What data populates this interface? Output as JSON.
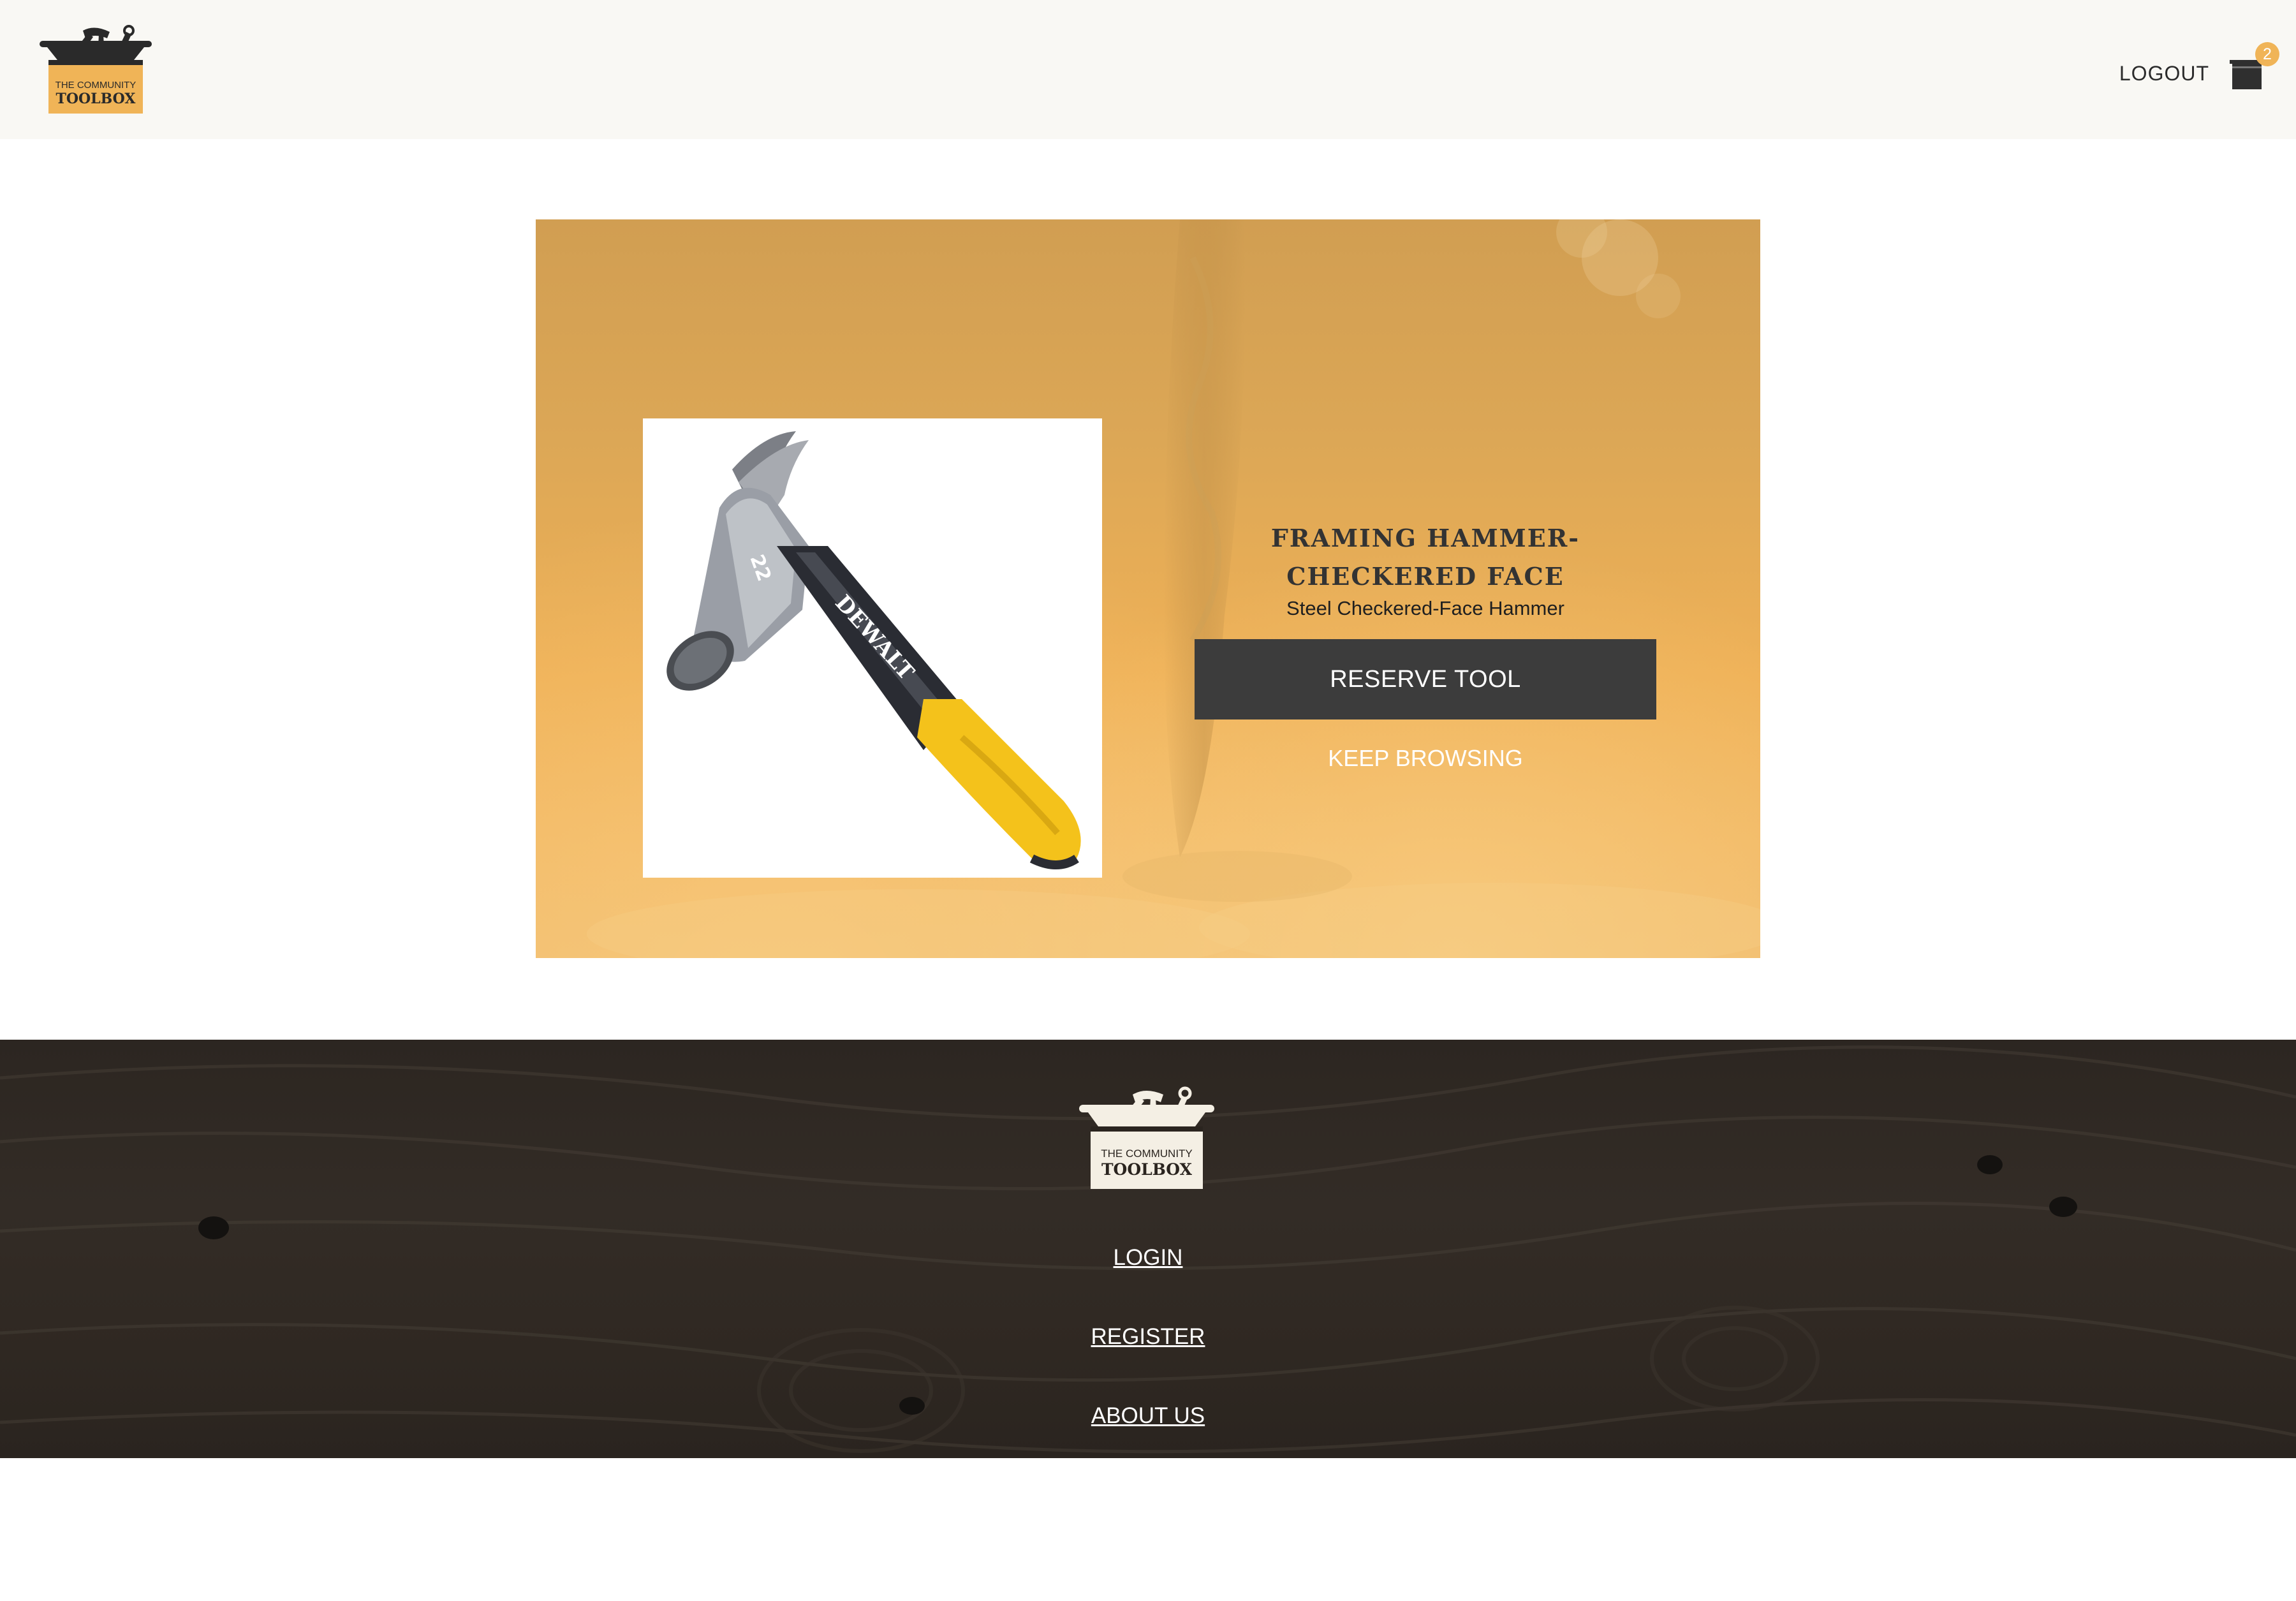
{
  "header": {
    "logo": {
      "icon": "toolbox-logo",
      "line1": "THE COMMUNITY",
      "line2": "TOOLBOX"
    },
    "logout_label": "LOGOUT",
    "cart": {
      "icon": "toolbox-cart-icon",
      "count": "2"
    }
  },
  "product": {
    "image_icon": "framing-hammer-image",
    "image_brand": "DEWALT",
    "image_number": "22",
    "title": "FRAMING HAMMER-CHECKERED FACE",
    "subtitle": "Steel Checkered-Face Hammer",
    "reserve_label": "RESERVE TOOL",
    "browse_label": "KEEP BROWSING"
  },
  "footer": {
    "logo": {
      "icon": "toolbox-logo",
      "line1": "THE COMMUNITY",
      "line2": "TOOLBOX"
    },
    "links": [
      "LOGIN",
      "REGISTER",
      "ABOUT US"
    ]
  },
  "colors": {
    "accent": "#f0b457",
    "hero_gold": "#dca756",
    "button_dark": "#3c3c3c",
    "header_bg": "#f9f8f4",
    "footer_wood": "#2f2822"
  }
}
